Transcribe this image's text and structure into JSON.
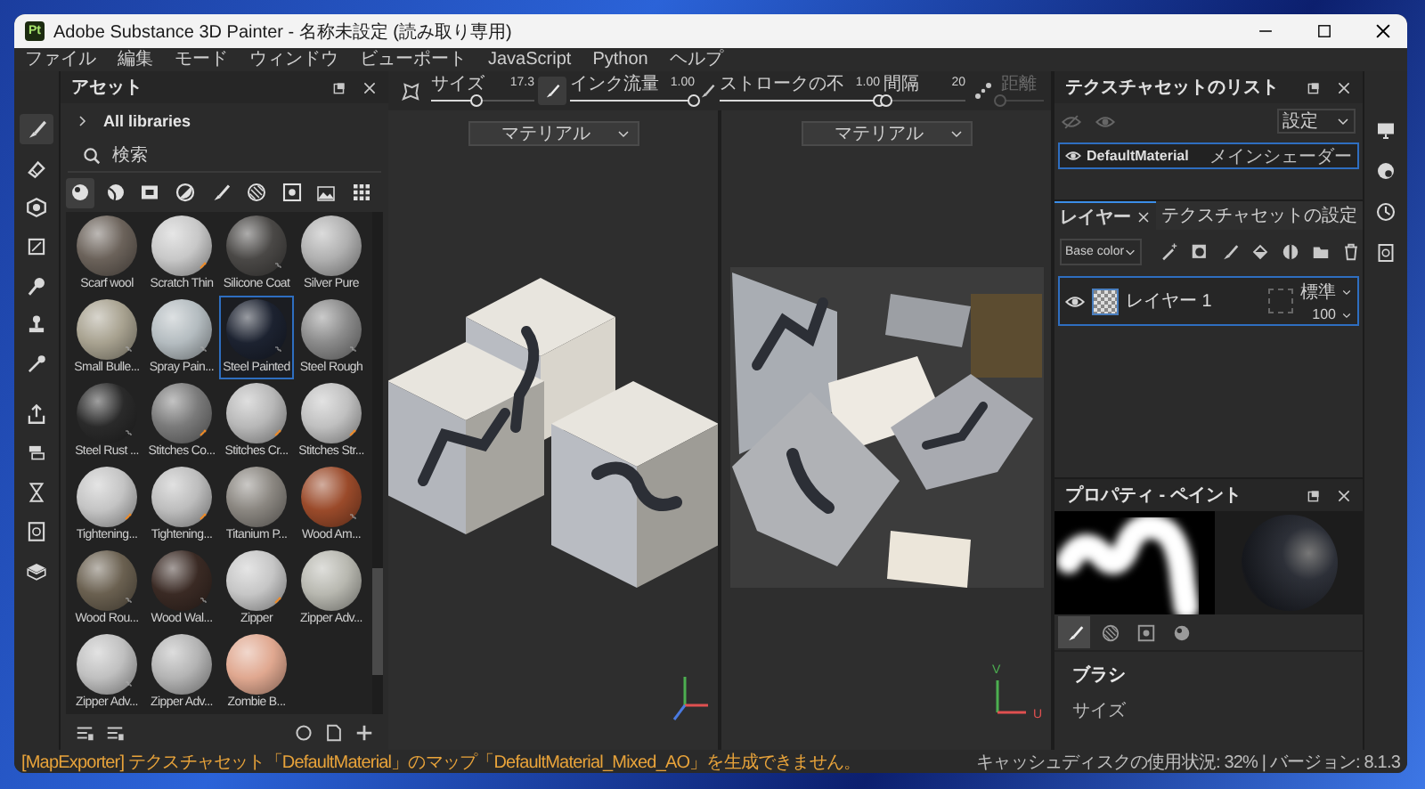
{
  "window": {
    "title": "Adobe Substance 3D Painter - 名称未設定 (読み取り専用)",
    "app_badge": "Pt"
  },
  "menu": [
    "ファイル",
    "編集",
    "モード",
    "ウィンドウ",
    "ビューポート",
    "JavaScript",
    "Python",
    "ヘルプ"
  ],
  "tools": [
    {
      "kind": "brush",
      "selected": true
    },
    {
      "kind": "eraser",
      "selected": false
    },
    {
      "kind": "projection",
      "selected": false
    },
    {
      "kind": "polygon_fill",
      "selected": false
    },
    {
      "kind": "smudge",
      "selected": false
    },
    {
      "kind": "clone",
      "selected": false
    },
    {
      "kind": "picker",
      "selected": false
    },
    {
      "kind": "export",
      "selected": false
    },
    {
      "kind": "bake",
      "selected": false
    },
    {
      "kind": "hourglass",
      "selected": false
    },
    {
      "kind": "document",
      "selected": false
    },
    {
      "kind": "cube",
      "selected": false
    }
  ],
  "assets_panel": {
    "title": "アセット",
    "library": "All libraries",
    "search": {
      "placeholder": "検索"
    },
    "filters": [
      {
        "kind": "material",
        "selected": true
      },
      {
        "kind": "smart_material",
        "selected": false
      },
      {
        "kind": "texture",
        "selected": false
      },
      {
        "kind": "filter",
        "selected": false
      },
      {
        "kind": "brush",
        "selected": false
      },
      {
        "kind": "pattern",
        "selected": false
      },
      {
        "kind": "alpha",
        "selected": false
      },
      {
        "kind": "environment",
        "selected": false
      }
    ],
    "items": [
      {
        "name": "Scarf wool",
        "color": "#6b625a",
        "kind": "basic",
        "selected": false
      },
      {
        "name": "Scratch Thin",
        "color": "#c8c8c8",
        "kind": "smart",
        "selected": false
      },
      {
        "name": "Silicone Coat",
        "color": "#4a4846",
        "kind": "material",
        "selected": false
      },
      {
        "name": "Silver Pure",
        "color": "#b0b0b0",
        "kind": "basic",
        "selected": false
      },
      {
        "name": "Small Bulle...",
        "color": "#a8a290",
        "kind": "material",
        "selected": false
      },
      {
        "name": "Spray Pain...",
        "color": "#b4bcc0",
        "kind": "material",
        "selected": false
      },
      {
        "name": "Steel Painted",
        "color": "#1c2230",
        "kind": "material",
        "selected": true
      },
      {
        "name": "Steel Rough",
        "color": "#8a8a8a",
        "kind": "material",
        "selected": false
      },
      {
        "name": "Steel Rust ...",
        "color": "#2a2a2a",
        "kind": "material",
        "selected": false
      },
      {
        "name": "Stitches Co...",
        "color": "#7a7a7a",
        "kind": "smart",
        "selected": false
      },
      {
        "name": "Stitches Cr...",
        "color": "#b8b8b8",
        "kind": "smart",
        "selected": false
      },
      {
        "name": "Stitches Str...",
        "color": "#c0c0c0",
        "kind": "smart",
        "selected": false
      },
      {
        "name": "Tightening...",
        "color": "#c4c4c4",
        "kind": "smart",
        "selected": false
      },
      {
        "name": "Tightening...",
        "color": "#bdbdbd",
        "kind": "smart",
        "selected": false
      },
      {
        "name": "Titanium P...",
        "color": "#8a8680",
        "kind": "basic",
        "selected": false
      },
      {
        "name": "Wood Am...",
        "color": "#9a4a2a",
        "kind": "material",
        "selected": false
      },
      {
        "name": "Wood Rou...",
        "color": "#6a6050",
        "kind": "material",
        "selected": false
      },
      {
        "name": "Wood Wal...",
        "color": "#3a2a24",
        "kind": "material",
        "selected": false
      },
      {
        "name": "Zipper",
        "color": "#c6c6c6",
        "kind": "smart",
        "selected": false
      },
      {
        "name": "Zipper Adv...",
        "color": "#b8b8b0",
        "kind": "basic",
        "selected": false
      },
      {
        "name": "Zipper Adv...",
        "color": "#c0c0c0",
        "kind": "material",
        "selected": false
      },
      {
        "name": "Zipper Adv...",
        "color": "#b4b4b4",
        "kind": "basic",
        "selected": false
      },
      {
        "name": "Zombie B...",
        "color": "#e0a890",
        "kind": "basic",
        "selected": false
      }
    ]
  },
  "toolbar": {
    "sliders": [
      {
        "label": "サイズ",
        "reading": "17.3",
        "level": 0.45,
        "disabled": false
      },
      {
        "label": "インク流量",
        "reading": "1.00",
        "level": 1,
        "disabled": false
      },
      {
        "label": "ストロークの不",
        "reading": "1.00",
        "level": 1,
        "disabled": false
      },
      {
        "label": "間隔",
        "reading": "20",
        "level": 0.05,
        "disabled": false
      },
      {
        "label": "距離",
        "level": 0,
        "disabled": true
      }
    ]
  },
  "viewports": [
    {
      "kind": "perspective",
      "dropdown": "マテリアル"
    },
    {
      "kind": "uv",
      "dropdown": "マテリアル",
      "axis_labels": [
        "V",
        "U"
      ]
    }
  ],
  "texture_set_list": {
    "title": "テクスチャセットのリスト",
    "dropdown": "設定",
    "rows": [
      {
        "name": "DefaultMaterial",
        "shader": "メインシェーダー",
        "selected": true
      }
    ]
  },
  "layers": {
    "tabs": [
      {
        "label": "レイヤー",
        "selected": true,
        "closable": true
      },
      {
        "label": "テクスチャセットの設定",
        "selected": false,
        "closable": false
      }
    ],
    "channel": "Base color",
    "rows": [
      {
        "name": "レイヤー 1",
        "blend": "標準",
        "opacity": "100",
        "selected": true,
        "visible": true
      }
    ]
  },
  "properties": {
    "title": "プロパティ - ペイント",
    "tabs": [
      {
        "kind": "brush",
        "selected": true
      },
      {
        "kind": "pattern",
        "selected": false
      },
      {
        "kind": "alpha",
        "selected": false
      },
      {
        "kind": "material",
        "selected": false
      }
    ],
    "section": "ブラシ",
    "field": "サイズ"
  },
  "status_bar": {
    "message": "[MapExporter] テクスチャセット「DefaultMaterial」のマップ「DefaultMaterial_Mixed_AO」を生成できません。",
    "info": "キャッシュディスクの使用状況: 32% | バージョン: 8.1.3"
  }
}
